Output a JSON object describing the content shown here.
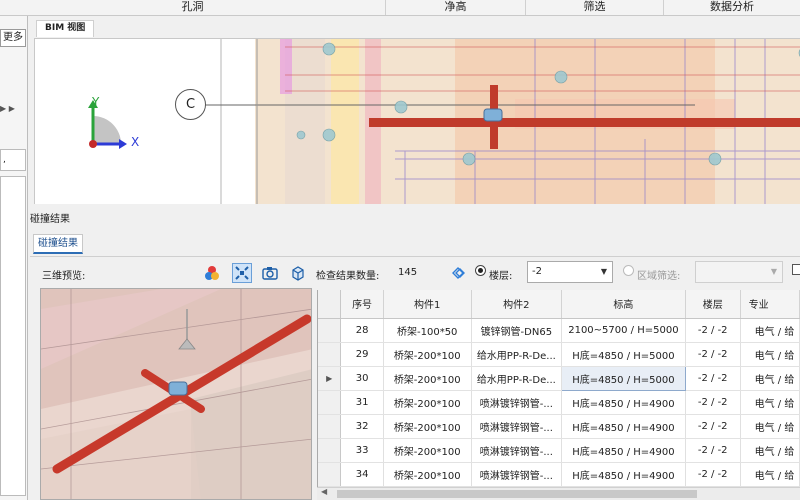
{
  "top_tabs": [
    "孔洞",
    "净高",
    "筛选",
    "数据分析"
  ],
  "left_panel": {
    "more_label": "更多",
    "box_label": ","
  },
  "bim_view": {
    "tab_label": "BIM 视图",
    "axis_y": "Y",
    "axis_x": "X",
    "grid_marker": "C"
  },
  "collision": {
    "header": "碰撞结果",
    "tab_label": "碰撞结果",
    "preview_label": "三维预览:",
    "count_label": "检查结果数量:",
    "count_value": "145",
    "floor_label": "楼层:",
    "floor_value": "-2",
    "region_label": "区域筛选:",
    "region_value": ""
  },
  "table": {
    "columns": [
      "序号",
      "构件1",
      "构件2",
      "标高",
      "楼层",
      "专业"
    ],
    "selected_row": 2,
    "rows": [
      [
        "28",
        "桥架-100*50",
        "镀锌钢管-DN65",
        "2100~5700 / H=5000",
        "-2 / -2",
        "电气 / 给"
      ],
      [
        "29",
        "桥架-200*100",
        "给水用PP-R-De...",
        "H底=4850 / H=5000",
        "-2 / -2",
        "电气 / 给"
      ],
      [
        "30",
        "桥架-200*100",
        "给水用PP-R-De...",
        "H底=4850 / H=5000",
        "-2 / -2",
        "电气 / 给"
      ],
      [
        "31",
        "桥架-200*100",
        "喷淋镀锌钢管-...",
        "H底=4850 / H=4900",
        "-2 / -2",
        "电气 / 给"
      ],
      [
        "32",
        "桥架-200*100",
        "喷淋镀锌钢管-...",
        "H底=4850 / H=4900",
        "-2 / -2",
        "电气 / 给"
      ],
      [
        "33",
        "桥架-200*100",
        "喷淋镀锌钢管-...",
        "H底=4850 / H=4900",
        "-2 / -2",
        "电气 / 给"
      ],
      [
        "34",
        "桥架-200*100",
        "喷淋镀锌钢管-...",
        "H底=4850 / H=4900",
        "-2 / -2",
        "电气 / 给"
      ]
    ]
  }
}
